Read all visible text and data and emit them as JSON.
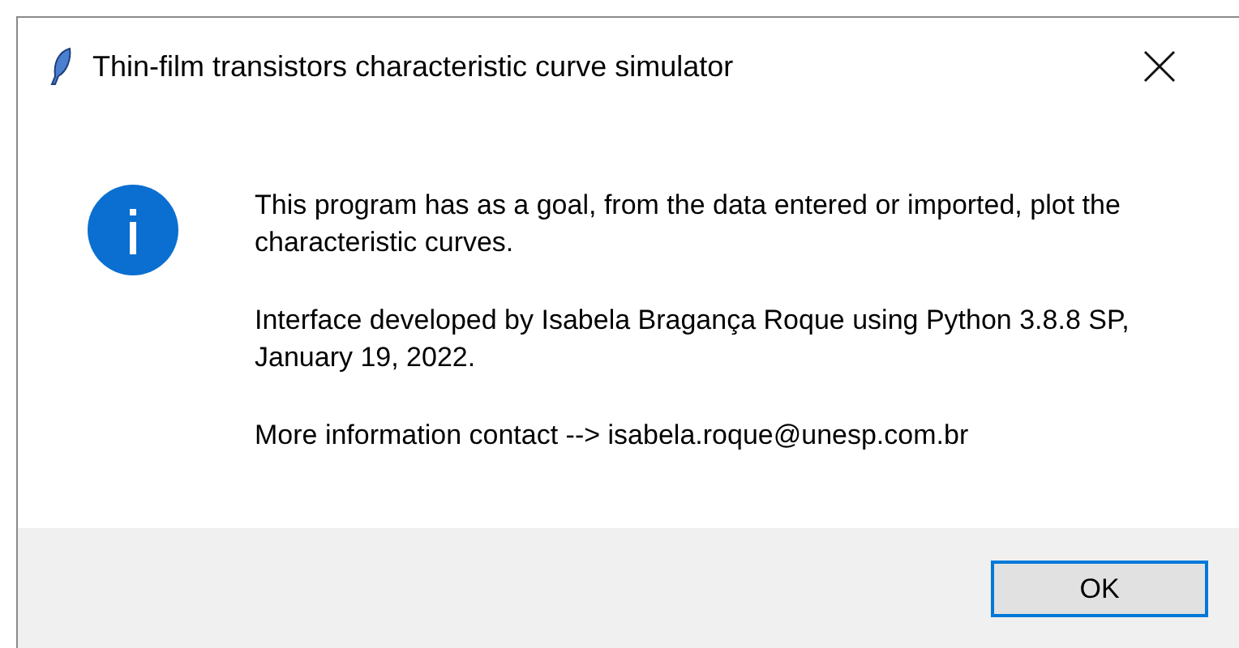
{
  "window": {
    "title": "Thin-film transistors characteristic curve simulator"
  },
  "message": {
    "paragraphs": [
      "This program has as a goal, from the data entered or imported, plot the characteristic curves.",
      "Interface developed by Isabela Bragança Roque using Python 3.8.8 SP, January 19, 2022.",
      "More information contact --> isabela.roque@unesp.com.br"
    ]
  },
  "buttons": [
    {
      "label": "OK",
      "selected": true
    }
  ]
}
